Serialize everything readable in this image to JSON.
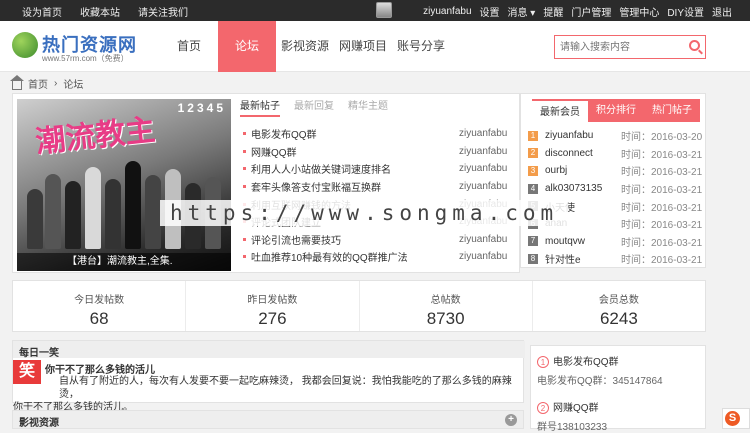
{
  "topbar": {
    "left": [
      "设为首页",
      "收藏本站",
      "请关注我们"
    ],
    "username": "ziyuanfabu",
    "right": [
      "设置",
      "消息",
      "提醒",
      "门户管理",
      "管理中心",
      "DIY设置",
      "退出"
    ]
  },
  "logo": {
    "name": "热门资源网",
    "sub": "www.57rm.com（免费）"
  },
  "nav": [
    "首页",
    "论坛",
    "影视资源",
    "网赚项目",
    "账号分享"
  ],
  "nav_active": "论坛",
  "search": {
    "placeholder": "请输入搜索内容"
  },
  "breadcrumb": [
    "首页",
    "论坛"
  ],
  "slider": {
    "pages": [
      "1",
      "2",
      "3",
      "4",
      "5"
    ],
    "title": "潮流教主",
    "caption": "【港台】潮流教主,全集."
  },
  "post_tabs": [
    "最新帖子",
    "最新回复",
    "精华主题"
  ],
  "posts": [
    {
      "title": "电影发布QQ群",
      "user": "ziyuanfabu"
    },
    {
      "title": "网赚QQ群",
      "user": "ziyuanfabu"
    },
    {
      "title": "利用人人小站做关键词速度排名",
      "user": "ziyuanfabu"
    },
    {
      "title": "套牢头像答支付宝账福互换群",
      "user": "ziyuanfabu"
    },
    {
      "title": "利用互联网赚钱的方法",
      "user": "ziyuanfabu"
    },
    {
      "title": "评论式团队建立",
      "user": "ziyuanfabu"
    },
    {
      "title": "评论引流也需要技巧",
      "user": "ziyuanfabu"
    },
    {
      "title": "吐血推荐10种最有效的QQ群推广法",
      "user": "ziyuanfabu"
    }
  ],
  "member_tabs": [
    "最新会员",
    "积分排行",
    "热门帖子"
  ],
  "members": [
    {
      "rank": "1",
      "name": "ziyuanfabu",
      "time": "时间：2016-03-20"
    },
    {
      "rank": "2",
      "name": "disconnect",
      "time": "时间：2016-03-21"
    },
    {
      "rank": "3",
      "name": "ourbj",
      "time": "时间：2016-03-21"
    },
    {
      "rank": "4",
      "name": "alk03073135",
      "time": "时间：2016-03-21"
    },
    {
      "rank": "5",
      "name": "小天使",
      "time": "时间：2016-03-21"
    },
    {
      "rank": "6",
      "name": "anan",
      "time": "时间：2016-03-21"
    },
    {
      "rank": "7",
      "name": "moutqvw",
      "time": "时间：2016-03-21"
    },
    {
      "rank": "8",
      "name": "针对性e",
      "time": "时间：2016-03-21"
    }
  ],
  "stats": [
    {
      "label": "今日发帖数",
      "value": "68"
    },
    {
      "label": "昨日发帖数",
      "value": "276"
    },
    {
      "label": "总帖数",
      "value": "8730"
    },
    {
      "label": "会员总数",
      "value": "6243"
    }
  ],
  "joke": {
    "header": "每日一笑",
    "icon": "笑",
    "title": "你干不了那么多钱的活儿",
    "line1": "自从有了附近的人，每次有人发要不要一起吃麻辣烫，    我都会回复说：我怕我能吃的了那么多钱的麻辣烫，",
    "line2": "你干不了那么多钱的活儿。"
  },
  "film": {
    "header": "影视资源",
    "plus": "+"
  },
  "side": [
    {
      "n": "1",
      "title": "电影发布QQ群",
      "sub": "电影发布QQ群：345147864"
    },
    {
      "n": "2",
      "title": "网赚QQ群",
      "sub": "群号138103233"
    }
  ],
  "watermark": "https://www.songma.com",
  "colors": {
    "accent": "#f3676d",
    "topbar": "#2b2b2b"
  }
}
